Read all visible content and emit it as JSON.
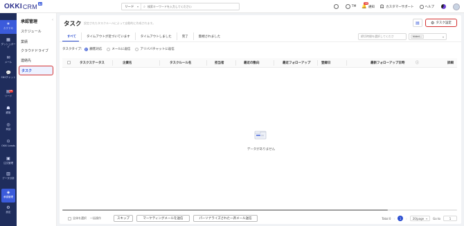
{
  "header": {
    "logo_main": "OKKI",
    "logo_crm": "CRM",
    "logo_tag": "AI",
    "search_scope": "リード",
    "search_placeholder": "検索キーワードを入力してください",
    "user_initials": "TM",
    "notifications_label": "通知",
    "notifications_count": "26",
    "support_label": "カスタマーサポート",
    "help_label": "ヘルプ"
  },
  "rail": [
    {
      "label": "おすすめ",
      "icon": "star-icon",
      "glyph": "★"
    },
    {
      "label": "ダッシュボード",
      "icon": "dashboard-icon",
      "glyph": "▦"
    },
    {
      "label": "メール",
      "icon": "mail-icon",
      "glyph": "✉"
    },
    {
      "label": "SNSチャット",
      "icon": "chat-icon",
      "glyph": "💬"
    },
    {
      "label": "リード",
      "icon": "leads-icon",
      "glyph": "▤",
      "badge": "15"
    },
    {
      "label": "顧客",
      "icon": "customer-icon",
      "glyph": "☗"
    },
    {
      "label": "商談",
      "icon": "deal-icon",
      "glyph": "◎"
    },
    {
      "label": "OKKI Leads",
      "icon": "okki-leads-icon",
      "glyph": "⊙"
    },
    {
      "label": "注文管理",
      "icon": "order-icon",
      "glyph": "▣"
    },
    {
      "label": "データ分析",
      "icon": "analytics-icon",
      "glyph": "▥"
    },
    {
      "label": "承認管理",
      "icon": "approval-icon",
      "glyph": "◈"
    },
    {
      "label": "設定",
      "icon": "settings-icon",
      "glyph": "⚙"
    }
  ],
  "submenu": {
    "title": "承認管理",
    "items": [
      "スケジュール",
      "業績",
      "クラウドドライブ",
      "連絡先",
      "タスク"
    ]
  },
  "page": {
    "title": "タスク",
    "subtitle": "設定されたタスクルールによって自動的に作成されます。",
    "settings_button": "タスク設定",
    "tabs": [
      "すべて",
      "タイムアウトが近づいています",
      "タイムアウトしました",
      "完了",
      "無視されました"
    ],
    "date_placeholder": "締切時間を選択してくださ",
    "owner_chip": "hideri...",
    "task_type_label": "タスクタイプ:",
    "task_types": [
      {
        "label": "顧客対応",
        "checked": true
      },
      {
        "label": "メールに返信",
        "checked": false
      },
      {
        "label": "アリババチャットに返信",
        "checked": false
      }
    ],
    "columns": [
      "タスクステータス",
      "企業名",
      "タスクルール名",
      "担当者",
      "最近の動向",
      "最近フォローアップ",
      "登録日",
      "最新フォローアップ日時",
      "詳細"
    ],
    "empty_text": "データがありません"
  },
  "footer": {
    "select_all": "全体を選択",
    "bulk_label": "一括操作",
    "buttons": [
      "スキップ",
      "マーケティングメールを送信",
      "パーソナライズされた一斉メール送信"
    ],
    "total": "Total 0",
    "current_page": "1",
    "page_size": "20/page",
    "goto_label": "Go to",
    "goto_value": "1"
  }
}
